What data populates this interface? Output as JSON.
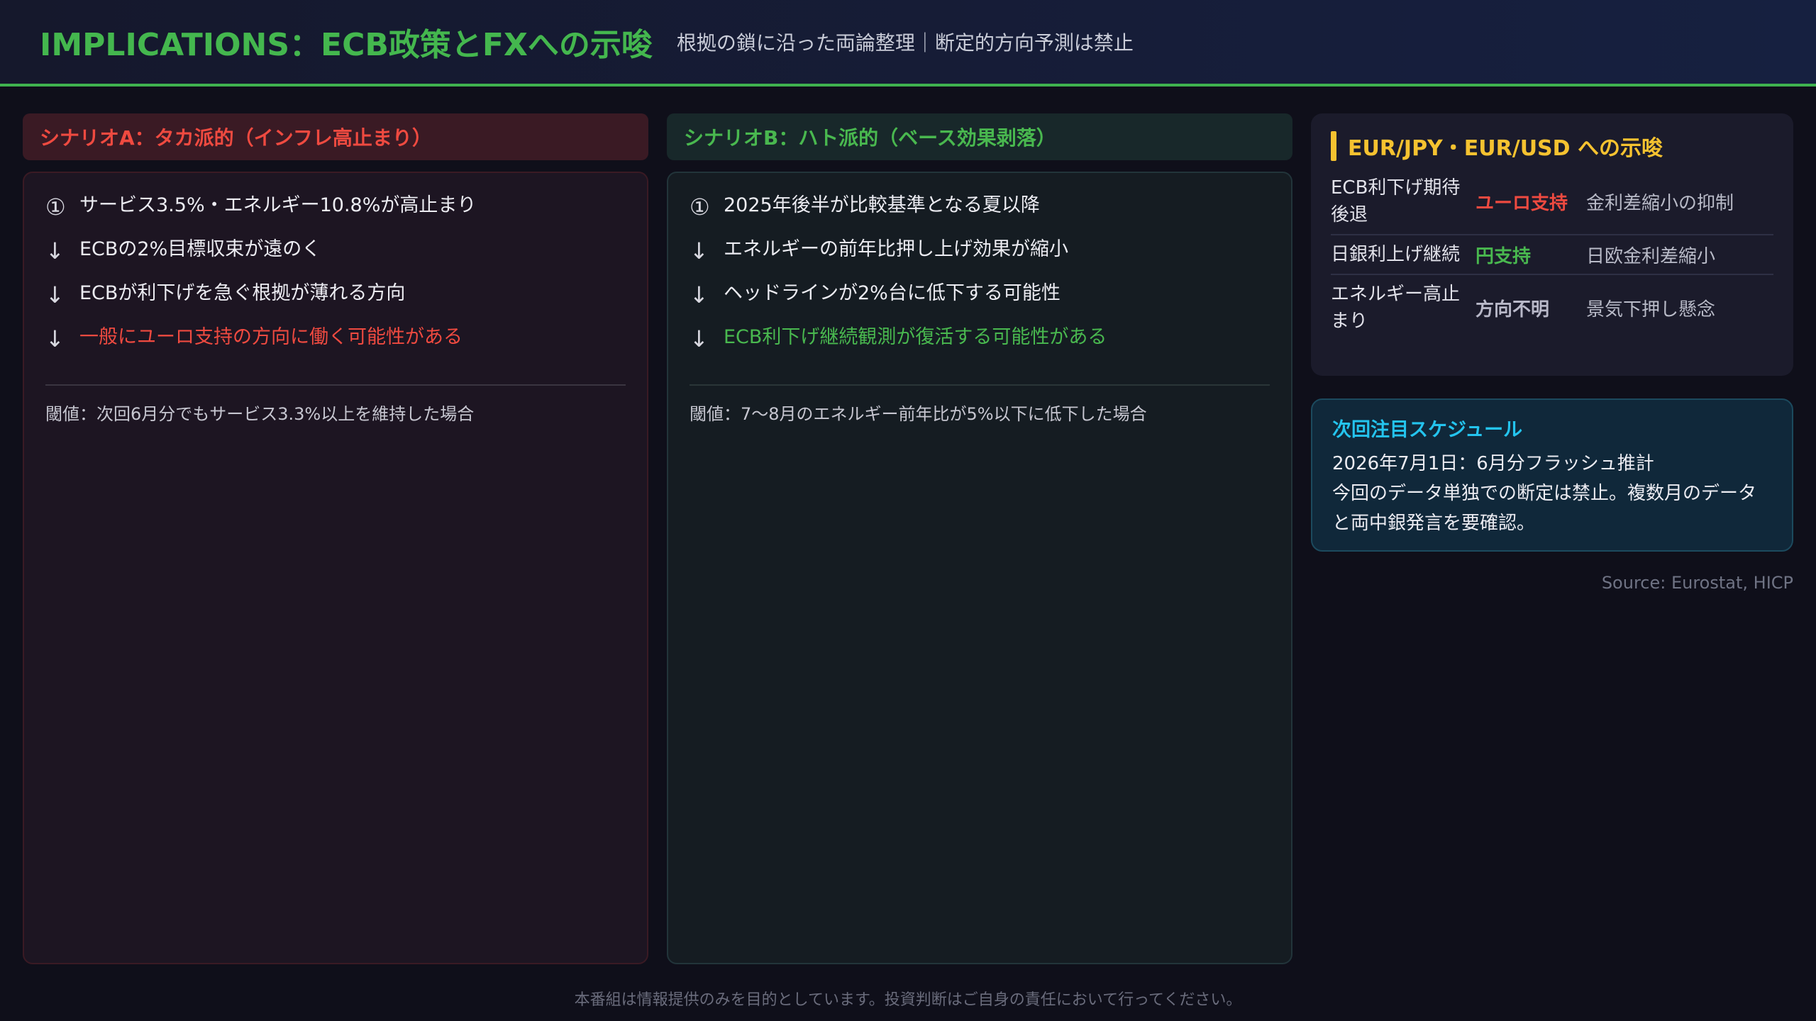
{
  "header": {
    "title": "IMPLICATIONS：ECB政策とFXへの示唆",
    "subtitle": "根拠の鎖に沿った両論整理｜断定的方向予測は禁止"
  },
  "scenario_a": {
    "title": "シナリオA：タカ派的（インフレ高止まり）",
    "steps": [
      {
        "icon": "①",
        "text": "サービス3.5%・エネルギー10.8%が高止まり"
      },
      {
        "icon": "↓",
        "text": "ECBの2%目標収束が遠のく"
      },
      {
        "icon": "↓",
        "text": "ECBが利下げを急ぐ根拠が薄れる方向"
      },
      {
        "icon": "↓",
        "text": "一般にユーロ支持の方向に働く可能性がある"
      }
    ],
    "threshold": "閾値：次回6月分でもサービス3.3%以上を維持した場合"
  },
  "scenario_b": {
    "title": "シナリオB：ハト派的（ベース効果剥落）",
    "steps": [
      {
        "icon": "①",
        "text": "2025年後半が比較基準となる夏以降"
      },
      {
        "icon": "↓",
        "text": "エネルギーの前年比押し上げ効果が縮小"
      },
      {
        "icon": "↓",
        "text": "ヘッドラインが2%台に低下する可能性"
      },
      {
        "icon": "↓",
        "text": "ECB利下げ継続観測が復活する可能性がある"
      }
    ],
    "threshold": "閾値：7〜8月のエネルギー前年比が5%以下に低下した場合"
  },
  "fx": {
    "title": "EUR/JPY・EUR/USD への示唆",
    "rows": [
      {
        "condition": "ECB利下げ期待後退",
        "direction": "ユーロ支持",
        "note": "金利差縮小の抑制"
      },
      {
        "condition": "日銀利上げ継続",
        "direction": "円支持",
        "note": "日欧金利差縮小"
      },
      {
        "condition": "エネルギー高止まり",
        "direction": "方向不明",
        "note": "景気下押し懸念"
      }
    ]
  },
  "schedule": {
    "title": "次回注目スケジュール",
    "line1": "2026年7月1日：6月分フラッシュ推計",
    "line2": "今回のデータ単独での断定は禁止。複数月のデータと両中銀発言を要確認。"
  },
  "source": "Source: Eurostat, HICP",
  "footer": "本番組は情報提供のみを目的としています。投資判断はご自身の責任において行ってください。",
  "colors": {
    "accent_green": "#44b74e",
    "accent_red": "#ef4a40",
    "accent_yellow": "#f5c230",
    "accent_cyan": "#24c4ee"
  }
}
